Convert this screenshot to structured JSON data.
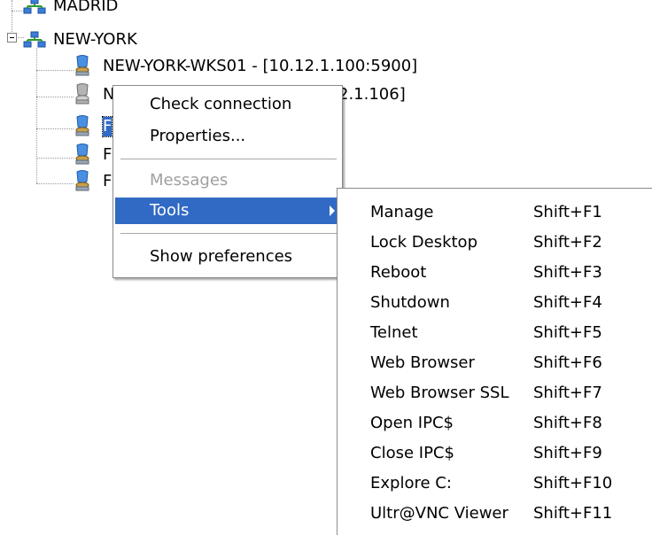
{
  "tree": {
    "groups": [
      {
        "label": "MADRID"
      },
      {
        "label": "NEW-YORK"
      }
    ],
    "hosts": [
      {
        "label": "NEW-YORK-WKS01 - [10.12.1.100:5900]",
        "icon": "computer-blue-icon"
      },
      {
        "label": "N",
        "suffix": "2.1.106]",
        "icon": "computer-gray-icon"
      },
      {
        "label": "F",
        "icon": "computer-blue-icon"
      },
      {
        "label": "F",
        "icon": "computer-blue-icon"
      },
      {
        "label": "F",
        "icon": "computer-blue-icon"
      }
    ]
  },
  "context_menu": {
    "items": [
      {
        "label": "Check connection"
      },
      {
        "label": "Properties..."
      },
      {
        "label": "Messages",
        "disabled": true
      },
      {
        "label": "Tools",
        "selected": true
      },
      {
        "label": "Show preferences"
      }
    ]
  },
  "tools_submenu": {
    "items": [
      {
        "label": "Manage",
        "shortcut": "Shift+F1"
      },
      {
        "label": "Lock Desktop",
        "shortcut": "Shift+F2"
      },
      {
        "label": "Reboot",
        "shortcut": "Shift+F3"
      },
      {
        "label": "Shutdown",
        "shortcut": "Shift+F4"
      },
      {
        "label": "Telnet",
        "shortcut": "Shift+F5"
      },
      {
        "label": "Web Browser",
        "shortcut": "Shift+F6"
      },
      {
        "label": "Web Browser SSL",
        "shortcut": "Shift+F7"
      },
      {
        "label": "Open IPC$",
        "shortcut": "Shift+F8"
      },
      {
        "label": "Close IPC$",
        "shortcut": "Shift+F9"
      },
      {
        "label": "Explore C:",
        "shortcut": "Shift+F10"
      },
      {
        "label": "Ultr@VNC Viewer",
        "shortcut": "Shift+F11"
      }
    ]
  },
  "colors": {
    "selection": "#316ac5",
    "disabled_text": "#a0a0a0",
    "tree_lines": "#9a9a9a"
  }
}
